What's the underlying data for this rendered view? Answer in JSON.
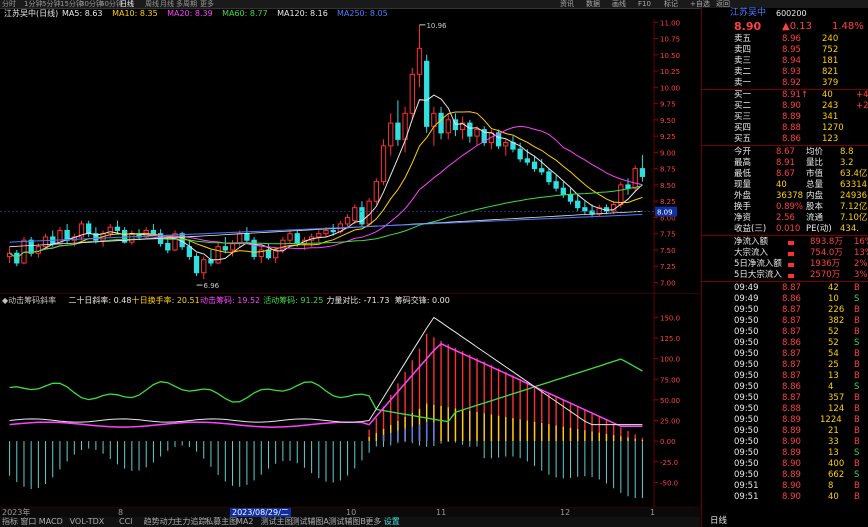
{
  "topbar": {
    "items": [
      "资讯",
      "数据",
      "画线",
      "F10",
      "标记",
      "+自选",
      "返回"
    ]
  },
  "timeframes": [
    "分时",
    "1分钟",
    "5分钟",
    "15分钟",
    "30分钟",
    "60分钟",
    "日线",
    "周线",
    "月线",
    "多周期",
    "更多"
  ],
  "ma_line": {
    "title": "江苏吴中(日线)",
    "items": [
      {
        "text": "MA5: 8.63",
        "color": "#e8e8e8"
      },
      {
        "text": "MA10: 8.35",
        "color": "#ffd000"
      },
      {
        "text": "MA20: 8.39",
        "color": "#ff40ff"
      },
      {
        "text": "MA60: 8.77",
        "color": "#3fdc3f"
      },
      {
        "text": "MA120: 8.16",
        "color": "#e8e8e8"
      },
      {
        "text": "MA250: 8.05",
        "color": "#4a7dff"
      }
    ]
  },
  "chart_data": [
    {
      "type": "candlestick",
      "title": "",
      "y_ticks": [
        "11.00",
        "10.75",
        "10.50",
        "10.25",
        "10.00",
        "9.75",
        "9.50",
        "9.25",
        "9.00",
        "8.75",
        "8.50",
        "8.25",
        "8.00",
        "7.75",
        "7.50",
        "7.25",
        "7.00"
      ],
      "ylim": [
        6.9,
        11.05
      ],
      "annotations": [
        "10.96",
        "6.96"
      ],
      "current_price_label": "8.09",
      "candles": [
        [
          7.4,
          7.55,
          7.3,
          7.45
        ],
        [
          7.45,
          7.5,
          7.25,
          7.3
        ],
        [
          7.3,
          7.7,
          7.28,
          7.65
        ],
        [
          7.65,
          7.7,
          7.4,
          7.45
        ],
        [
          7.45,
          7.6,
          7.38,
          7.55
        ],
        [
          7.55,
          7.75,
          7.5,
          7.7
        ],
        [
          7.7,
          7.8,
          7.55,
          7.6
        ],
        [
          7.6,
          7.85,
          7.58,
          7.8
        ],
        [
          7.8,
          7.9,
          7.6,
          7.65
        ],
        [
          7.65,
          7.75,
          7.55,
          7.7
        ],
        [
          7.7,
          7.95,
          7.65,
          7.9
        ],
        [
          7.9,
          7.95,
          7.7,
          7.75
        ],
        [
          7.75,
          7.85,
          7.6,
          7.65
        ],
        [
          7.65,
          7.8,
          7.55,
          7.75
        ],
        [
          7.75,
          7.9,
          7.7,
          7.85
        ],
        [
          7.85,
          7.95,
          7.75,
          7.8
        ],
        [
          7.8,
          7.85,
          7.6,
          7.62
        ],
        [
          7.62,
          7.8,
          7.58,
          7.75
        ],
        [
          7.75,
          7.82,
          7.65,
          7.7
        ],
        [
          7.7,
          7.85,
          7.68,
          7.8
        ],
        [
          7.8,
          7.9,
          7.72,
          7.75
        ],
        [
          7.75,
          7.82,
          7.55,
          7.6
        ],
        [
          7.6,
          7.7,
          7.45,
          7.5
        ],
        [
          7.5,
          7.8,
          7.48,
          7.75
        ],
        [
          7.75,
          7.78,
          7.5,
          7.55
        ],
        [
          7.55,
          7.65,
          7.35,
          7.4
        ],
        [
          7.4,
          7.45,
          7.1,
          7.15
        ],
        [
          7.15,
          7.4,
          7.05,
          7.35
        ],
        [
          7.35,
          7.5,
          7.25,
          7.3
        ],
        [
          7.3,
          7.6,
          7.28,
          7.55
        ],
        [
          7.55,
          7.7,
          7.45,
          7.5
        ],
        [
          7.5,
          7.65,
          7.4,
          7.6
        ],
        [
          7.6,
          7.8,
          7.55,
          7.75
        ],
        [
          7.75,
          7.85,
          7.6,
          7.65
        ],
        [
          7.65,
          7.7,
          7.35,
          7.4
        ],
        [
          7.4,
          7.55,
          7.3,
          7.5
        ],
        [
          7.5,
          7.6,
          7.35,
          7.38
        ],
        [
          7.38,
          7.55,
          7.3,
          7.5
        ],
        [
          7.5,
          7.7,
          7.45,
          7.65
        ],
        [
          7.65,
          7.8,
          7.6,
          7.75
        ],
        [
          7.75,
          7.8,
          7.55,
          7.6
        ],
        [
          7.6,
          7.7,
          7.5,
          7.65
        ],
        [
          7.65,
          7.75,
          7.55,
          7.7
        ],
        [
          7.7,
          7.8,
          7.62,
          7.75
        ],
        [
          7.75,
          7.85,
          7.7,
          7.8
        ],
        [
          7.8,
          7.9,
          7.72,
          7.78
        ],
        [
          7.78,
          7.95,
          7.75,
          7.9
        ],
        [
          7.9,
          8.05,
          7.85,
          8.0
        ],
        [
          7.95,
          8.2,
          7.9,
          8.15
        ],
        [
          8.15,
          8.25,
          7.85,
          7.9
        ],
        [
          7.9,
          8.3,
          7.88,
          8.25
        ],
        [
          8.25,
          8.6,
          8.2,
          8.55
        ],
        [
          8.55,
          9.2,
          8.5,
          9.1
        ],
        [
          9.1,
          9.6,
          8.95,
          9.45
        ],
        [
          9.45,
          9.8,
          9.1,
          9.2
        ],
        [
          9.2,
          9.7,
          9.0,
          9.6
        ],
        [
          9.6,
          10.3,
          9.5,
          10.2
        ],
        [
          10.2,
          10.96,
          10.0,
          10.6
        ],
        [
          10.4,
          10.5,
          9.3,
          9.4
        ],
        [
          9.4,
          9.7,
          9.1,
          9.6
        ],
        [
          9.6,
          9.7,
          9.2,
          9.3
        ],
        [
          9.3,
          9.6,
          9.2,
          9.5
        ],
        [
          9.5,
          9.6,
          9.25,
          9.35
        ],
        [
          9.35,
          9.55,
          9.2,
          9.45
        ],
        [
          9.45,
          9.5,
          9.15,
          9.25
        ],
        [
          9.25,
          9.4,
          9.1,
          9.35
        ],
        [
          9.35,
          9.4,
          9.1,
          9.15
        ],
        [
          9.15,
          9.35,
          9.05,
          9.3
        ],
        [
          9.3,
          9.35,
          9.05,
          9.1
        ],
        [
          9.1,
          9.2,
          8.95,
          9.15
        ],
        [
          9.15,
          9.25,
          9.0,
          9.05
        ],
        [
          9.05,
          9.15,
          8.85,
          8.9
        ],
        [
          8.9,
          9.05,
          8.8,
          8.85
        ],
        [
          8.85,
          8.95,
          8.7,
          8.75
        ],
        [
          8.75,
          8.9,
          8.65,
          8.7
        ],
        [
          8.7,
          8.75,
          8.5,
          8.55
        ],
        [
          8.55,
          8.65,
          8.4,
          8.45
        ],
        [
          8.45,
          8.55,
          8.3,
          8.35
        ],
        [
          8.35,
          8.45,
          8.2,
          8.25
        ],
        [
          8.25,
          8.35,
          8.1,
          8.15
        ],
        [
          8.15,
          8.25,
          8.05,
          8.1
        ],
        [
          8.1,
          8.2,
          8.0,
          8.05
        ],
        [
          8.05,
          8.2,
          8.02,
          8.15
        ],
        [
          8.15,
          8.2,
          8.05,
          8.1
        ],
        [
          8.1,
          8.25,
          8.05,
          8.2
        ],
        [
          8.2,
          8.55,
          8.15,
          8.5
        ],
        [
          8.5,
          8.6,
          8.35,
          8.45
        ],
        [
          8.45,
          8.8,
          8.4,
          8.75
        ],
        [
          8.75,
          8.96,
          8.55,
          8.63
        ]
      ]
    },
    {
      "type": "indicator",
      "title": "",
      "y_ticks": [
        "150.0",
        "125.0",
        "100.0",
        "75.00",
        "50.00",
        "25.00",
        "0.00",
        "-25.0",
        "-50.0"
      ],
      "ylim": [
        -75,
        165
      ]
    }
  ],
  "indicator_line": {
    "items": [
      {
        "text": "◆动击筹码斜率",
        "color": "#c0c0c0"
      },
      {
        "text": "二十日斜率: 0.48",
        "color": "#e8e8e8"
      },
      {
        "text": "十日换手率: 20.51",
        "color": "#ffd000"
      },
      {
        "text": "动击筹码: 19.52",
        "color": "#ff40ff"
      },
      {
        "text": "活动筹码: 91.25",
        "color": "#3fdc3f"
      },
      {
        "text": "力量对比: -71.73",
        "color": "#e8e8e8"
      },
      {
        "text": "筹码交锋: 0.00",
        "color": "#e8e8e8"
      }
    ]
  },
  "bottom_dates": [
    "2023年",
    "8",
    "2023/08/29/二",
    "10",
    "11",
    "12",
    "1"
  ],
  "bottom_tabs": [
    "指标",
    "窗口",
    "MACD",
    "VOL-TDX",
    "CCI",
    "趋势动力",
    "主力追踪",
    "私募主图",
    "MA2",
    "测试主图",
    "测试辅图A",
    "测试辅图B",
    "更多",
    "设置"
  ],
  "right_panel": {
    "name": "江苏吴中",
    "code": "600200",
    "price": "8.90",
    "change": "▲0.13",
    "pct": "1.48%",
    "order_book": [
      {
        "label": "卖五",
        "price": "8.96",
        "vol": "240",
        "chg": ""
      },
      {
        "label": "卖四",
        "price": "8.95",
        "vol": "752",
        "chg": ""
      },
      {
        "label": "卖三",
        "price": "8.94",
        "vol": "181",
        "chg": ""
      },
      {
        "label": "卖二",
        "price": "8.93",
        "vol": "821",
        "chg": ""
      },
      {
        "label": "卖一",
        "price": "8.92",
        "vol": "379",
        "chg": ""
      },
      {
        "label": "买一",
        "price": "8.91↑",
        "vol": "40",
        "chg": "+4"
      },
      {
        "label": "买二",
        "price": "8.90",
        "vol": "243",
        "chg": "+29"
      },
      {
        "label": "买三",
        "price": "8.89",
        "vol": "341",
        "chg": ""
      },
      {
        "label": "买四",
        "price": "8.88",
        "vol": "1270",
        "chg": ""
      },
      {
        "label": "买五",
        "price": "8.86",
        "vol": "123",
        "chg": ""
      }
    ],
    "stats": [
      {
        "l1": "今开",
        "v1": "8.67",
        "l2": "均价",
        "v2": "8.8"
      },
      {
        "l1": "最高",
        "v1": "8.91",
        "l2": "量比",
        "v2": "3.2"
      },
      {
        "l1": "最低",
        "v1": "8.67",
        "l2": "市值",
        "v2": "63.4亿"
      },
      {
        "l1": "现量",
        "v1": "40",
        "l2": "总量",
        "v2": "63314"
      },
      {
        "l1": "外盘",
        "v1": "36378",
        "l2": "内盘",
        "v2": "24936"
      },
      {
        "l1": "换手",
        "v1": "0.89%",
        "l2": "股本",
        "v2": "7.12亿"
      },
      {
        "l1": "净资",
        "v1": "2.56",
        "l2": "流通",
        "v2": "7.10亿"
      },
      {
        "l1": "收益(三)",
        "v1": "0.010",
        "l2": "PE(动)",
        "v2": "434."
      }
    ],
    "flows": [
      {
        "label": "净流入额",
        "value": "893.8万",
        "pct": "16%"
      },
      {
        "label": "大宗流入",
        "value": "754.0万",
        "pct": "13%"
      },
      {
        "label": "5日净流入额",
        "value": "1936万",
        "pct": "2%"
      },
      {
        "label": "5日大宗流入",
        "value": "2570万",
        "pct": "3%"
      }
    ],
    "ticks": [
      {
        "t": "09:49",
        "p": "8.87",
        "v": "42",
        "s": "B"
      },
      {
        "t": "09:49",
        "p": "8.86",
        "v": "10",
        "s": "S"
      },
      {
        "t": "09:50",
        "p": "8.87",
        "v": "226",
        "s": "B"
      },
      {
        "t": "09:50",
        "p": "8.87",
        "v": "382",
        "s": "B"
      },
      {
        "t": "09:50",
        "p": "8.87",
        "v": "52",
        "s": "B"
      },
      {
        "t": "09:50",
        "p": "8.86",
        "v": "52",
        "s": "S"
      },
      {
        "t": "09:50",
        "p": "8.87",
        "v": "54",
        "s": "B"
      },
      {
        "t": "09:50",
        "p": "8.87",
        "v": "25",
        "s": "B"
      },
      {
        "t": "09:50",
        "p": "8.87",
        "v": "13",
        "s": "B"
      },
      {
        "t": "09:50",
        "p": "8.86",
        "v": "4",
        "s": "S"
      },
      {
        "t": "09:50",
        "p": "8.87",
        "v": "357",
        "s": "B"
      },
      {
        "t": "09:50",
        "p": "8.88",
        "v": "124",
        "s": "B"
      },
      {
        "t": "09:50",
        "p": "8.89",
        "v": "1224",
        "s": "B"
      },
      {
        "t": "09:50",
        "p": "8.89",
        "v": "21",
        "s": "B"
      },
      {
        "t": "09:50",
        "p": "8.90",
        "v": "33",
        "s": "B"
      },
      {
        "t": "09:50",
        "p": "8.89",
        "v": "13",
        "s": "S"
      },
      {
        "t": "09:50",
        "p": "8.90",
        "v": "400",
        "s": "B"
      },
      {
        "t": "09:50",
        "p": "8.89",
        "v": "662",
        "s": "S"
      },
      {
        "t": "09:51",
        "p": "8.90",
        "v": "8",
        "s": "B"
      },
      {
        "t": "09:51",
        "p": "8.90",
        "v": "40",
        "s": "B"
      }
    ],
    "footer_tab": "日线"
  }
}
